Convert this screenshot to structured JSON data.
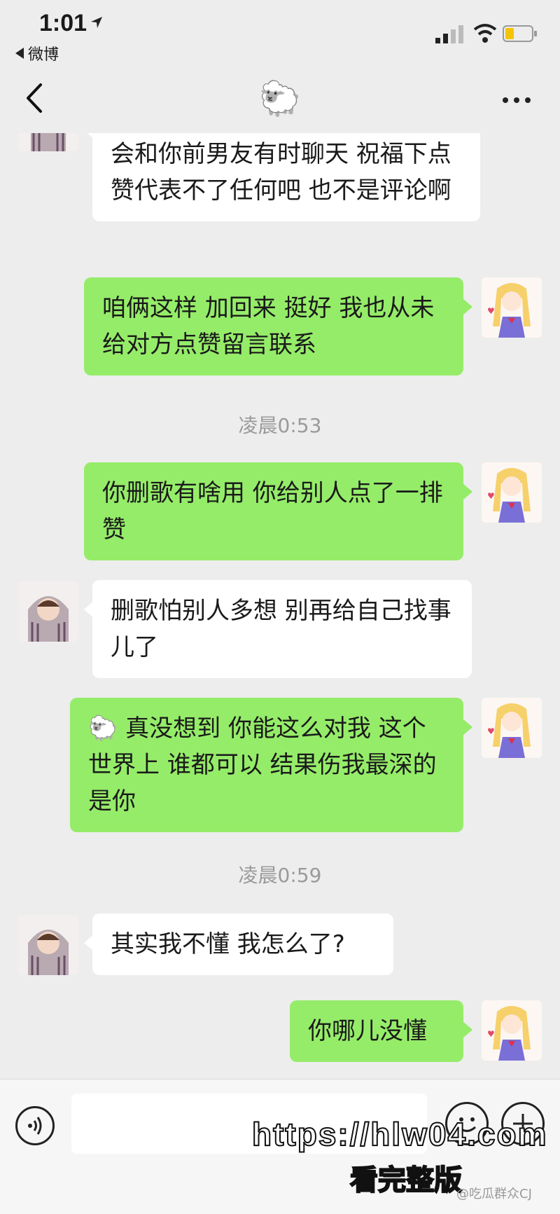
{
  "status_bar": {
    "time": "1:01",
    "back_app": "微博"
  },
  "nav": {
    "title": "🐑"
  },
  "messages": [
    {
      "text": "会和你前男友有时聊天 祝福下点赞代表不了任何吧 也不是评论啊"
    },
    {
      "text": "咱俩这样 加回来 挺好  我也从未给对方点赞留言联系"
    },
    {
      "text": "你删歌有啥用 你给别人点了一排赞"
    },
    {
      "text": "删歌怕别人多想 别再给自己找事儿了"
    },
    {
      "text": "🐑 真没想到 你能这么对我 这个世界上 谁都可以  结果伤我最深的是你"
    },
    {
      "text": "其实我不懂 我怎么了?"
    },
    {
      "text": "你哪儿没懂"
    }
  ],
  "timestamps": [
    "凌晨0:53",
    "凌晨0:59"
  ],
  "watermark": {
    "url": "https://hlw04.com",
    "cta": "看完整版",
    "credit": "@吃瓜群众CJ"
  },
  "colors": {
    "background": "#ededed",
    "bubble_sent": "#95ec69",
    "bubble_received": "#ffffff"
  }
}
